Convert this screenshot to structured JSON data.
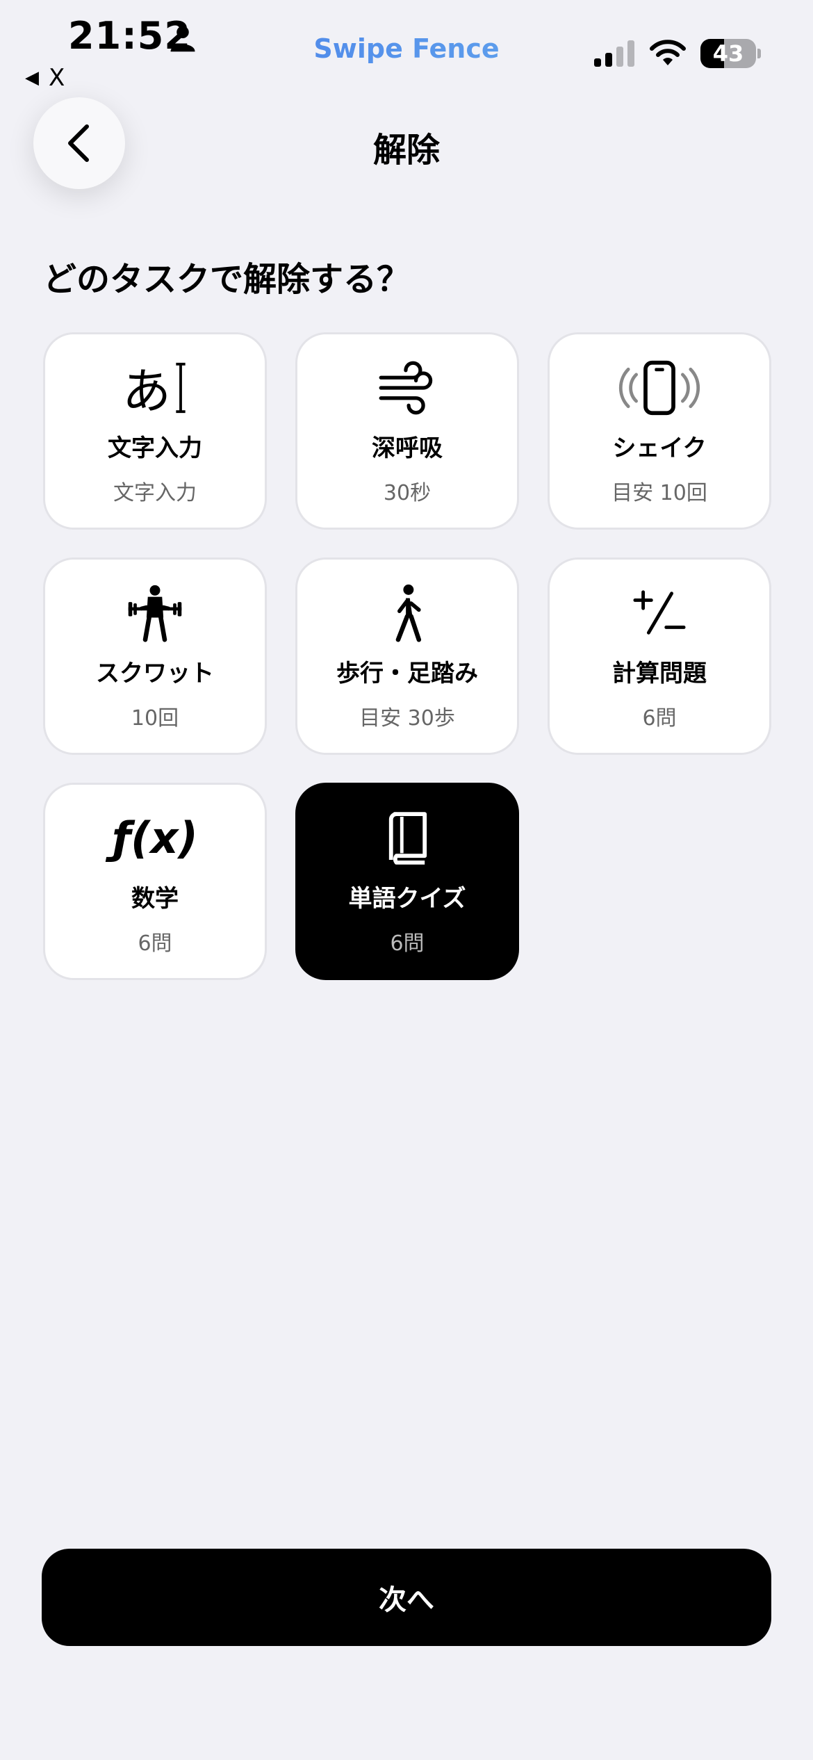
{
  "status_bar": {
    "time": "21:52",
    "back_app_label": "X",
    "battery_percent": 43,
    "battery_label": "43"
  },
  "app": {
    "brand": "Swipe Fence",
    "brand_colors": [
      "#3f72e8",
      "#6fb7ee"
    ]
  },
  "header": {
    "title": "解除"
  },
  "main": {
    "heading": "どのタスクで解除する？",
    "tasks": [
      {
        "name": "文字入力",
        "sub": "文字入力",
        "icon": "text-input-icon",
        "glyph": "あ",
        "selected": false
      },
      {
        "name": "深呼吸",
        "sub": "30秒",
        "icon": "wind-icon",
        "selected": false
      },
      {
        "name": "シェイク",
        "sub": "目安 10回",
        "icon": "phone-shake-icon",
        "selected": false
      },
      {
        "name": "スクワット",
        "sub": "10回",
        "icon": "weightlifting-icon",
        "selected": false
      },
      {
        "name": "歩行・足踏み",
        "sub": "目安 30歩",
        "icon": "walking-icon",
        "selected": false
      },
      {
        "name": "計算問題",
        "sub": "6問",
        "icon": "plus-minus-icon",
        "selected": false
      },
      {
        "name": "数学",
        "sub": "6問",
        "icon": "function-icon",
        "glyph": "ƒ(x)",
        "selected": false
      },
      {
        "name": "単語クイズ",
        "sub": "6問",
        "icon": "book-icon",
        "selected": true
      }
    ]
  },
  "footer": {
    "next_label": "次へ"
  },
  "colors": {
    "background": "#f1f1f6",
    "card": "#ffffff",
    "selected_card": "#000000",
    "primary_button": "#000000"
  }
}
